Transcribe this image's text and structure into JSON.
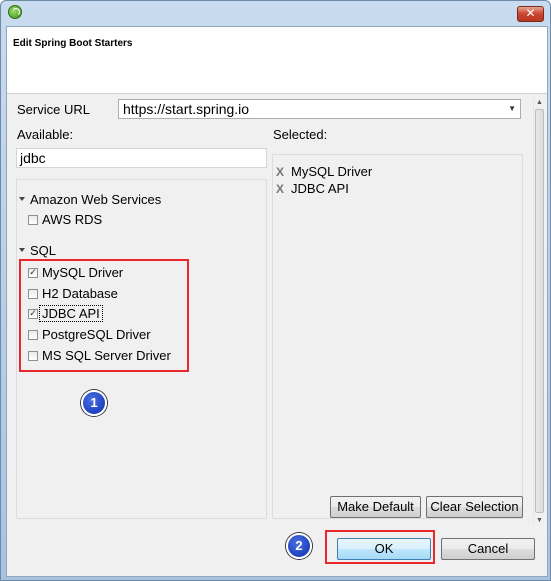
{
  "dialog": {
    "title": "Edit Spring Boot Starters",
    "close_symbol": "✕"
  },
  "service_url": {
    "label": "Service URL",
    "value": "https://start.spring.io"
  },
  "available": {
    "label": "Available:",
    "search_value": "jdbc",
    "groups": [
      {
        "name": "Amazon Web Services",
        "items": [
          {
            "label": "AWS RDS",
            "checked": false
          }
        ]
      },
      {
        "name": "SQL",
        "items": [
          {
            "label": "MySQL Driver",
            "checked": true
          },
          {
            "label": "H2 Database",
            "checked": false
          },
          {
            "label": "JDBC API",
            "checked": true
          },
          {
            "label": "PostgreSQL Driver",
            "checked": false
          },
          {
            "label": "MS SQL Server Driver",
            "checked": false
          }
        ]
      }
    ]
  },
  "selected": {
    "label": "Selected:",
    "remove_symbol": "X",
    "items": [
      "MySQL Driver",
      "JDBC API"
    ]
  },
  "buttons": {
    "make_default": "Make Default",
    "clear_selection": "Clear Selection",
    "ok": "OK",
    "cancel": "Cancel"
  },
  "annotations": {
    "badge_1": "1",
    "badge_2": "2"
  },
  "colors": {
    "highlight": "#e8282a",
    "badge": "#0b2fb0"
  },
  "check_symbol": "✓"
}
